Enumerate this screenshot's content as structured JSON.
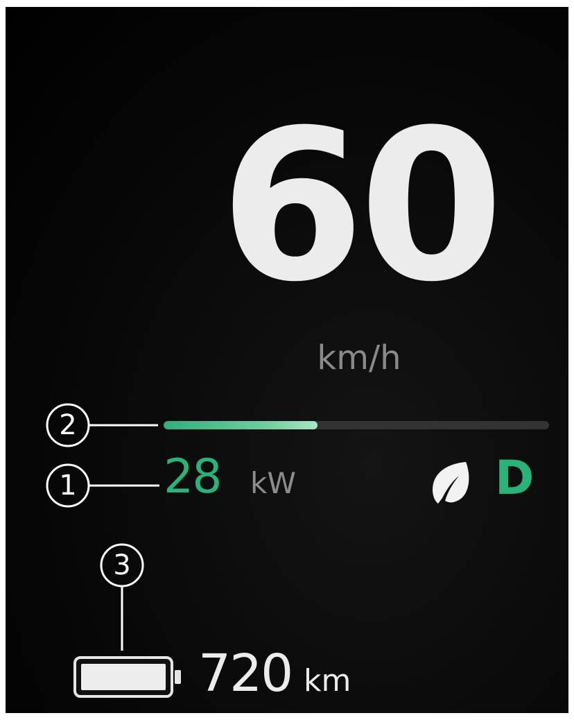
{
  "speed": {
    "value": "60",
    "unit": "km/h"
  },
  "power": {
    "value": "28",
    "unit": "kW",
    "bar_level": 0.4
  },
  "drive_mode": {
    "icon": "leaf-icon",
    "gear": "D"
  },
  "range": {
    "icon": "battery-icon",
    "value": "720",
    "unit": "km"
  },
  "callouts": [
    "1",
    "2",
    "3"
  ],
  "colors": {
    "accent_green": "#2ab27b",
    "speed_text": "#ececec",
    "muted_text": "#8a8a8a",
    "track": "#333333",
    "background": "#000000",
    "callout": "#ffffff"
  }
}
